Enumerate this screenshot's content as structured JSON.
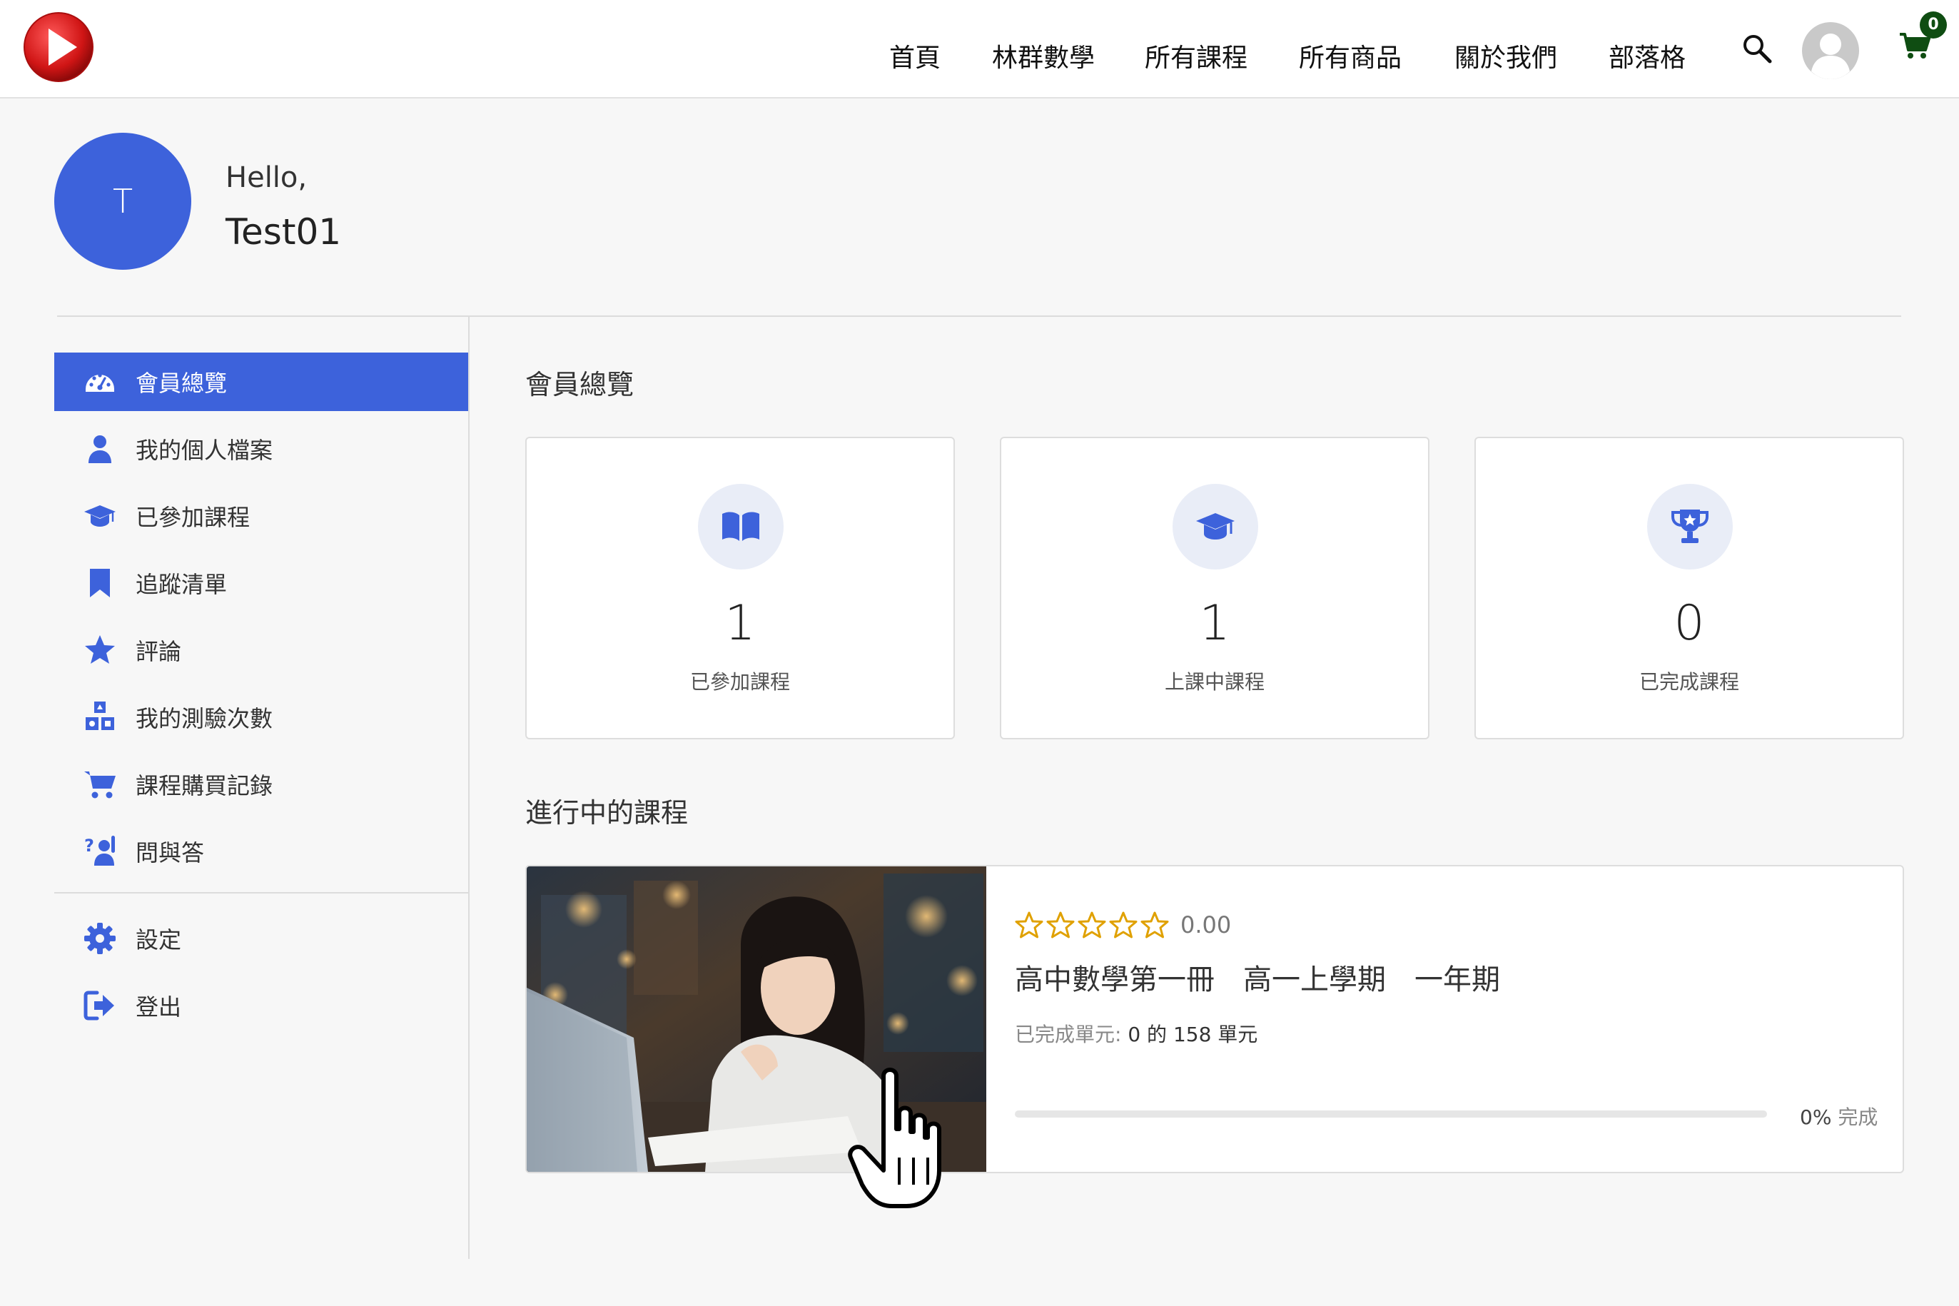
{
  "header": {
    "nav": [
      "首頁",
      "林群數學",
      "所有課程",
      "所有商品",
      "關於我們",
      "部落格"
    ],
    "cart_count": "0",
    "colors": {
      "brand_red": "#d81b1b",
      "cart_green": "#0f4d12"
    }
  },
  "profile": {
    "initial": "T",
    "hello": "Hello,",
    "name": "Test01",
    "avatar_color": "#3d62db"
  },
  "sidebar": {
    "items": [
      {
        "label": "會員總覽",
        "icon": "dashboard-gauge-icon",
        "active": true
      },
      {
        "label": "我的個人檔案",
        "icon": "user-icon"
      },
      {
        "label": "已參加課程",
        "icon": "graduation-cap-icon"
      },
      {
        "label": "追蹤清單",
        "icon": "bookmark-icon"
      },
      {
        "label": "評論",
        "icon": "star-icon"
      },
      {
        "label": "我的測驗次數",
        "icon": "quiz-shapes-icon"
      },
      {
        "label": "課程購買記錄",
        "icon": "shopping-cart-icon"
      },
      {
        "label": "問與答",
        "icon": "question-person-icon"
      }
    ],
    "bottom_items": [
      {
        "label": "設定",
        "icon": "gear-icon"
      },
      {
        "label": "登出",
        "icon": "logout-icon"
      }
    ]
  },
  "main": {
    "overview_title": "會員總覽",
    "stats": [
      {
        "value": "1",
        "label": "已參加課程",
        "icon": "open-book-icon"
      },
      {
        "value": "1",
        "label": "上課中課程",
        "icon": "graduation-cap-icon"
      },
      {
        "value": "0",
        "label": "已完成課程",
        "icon": "trophy-icon"
      }
    ],
    "in_progress_title": "進行中的課程",
    "course": {
      "rating_stars": 0,
      "rating": "0.00",
      "title": "高中數學第一冊　高一上學期　一年期",
      "completed_label": "已完成單元:",
      "completed_value": "0 的 158 單元",
      "progress_percent": 0,
      "progress_pct_text": "0%",
      "progress_suffix": "完成"
    }
  }
}
